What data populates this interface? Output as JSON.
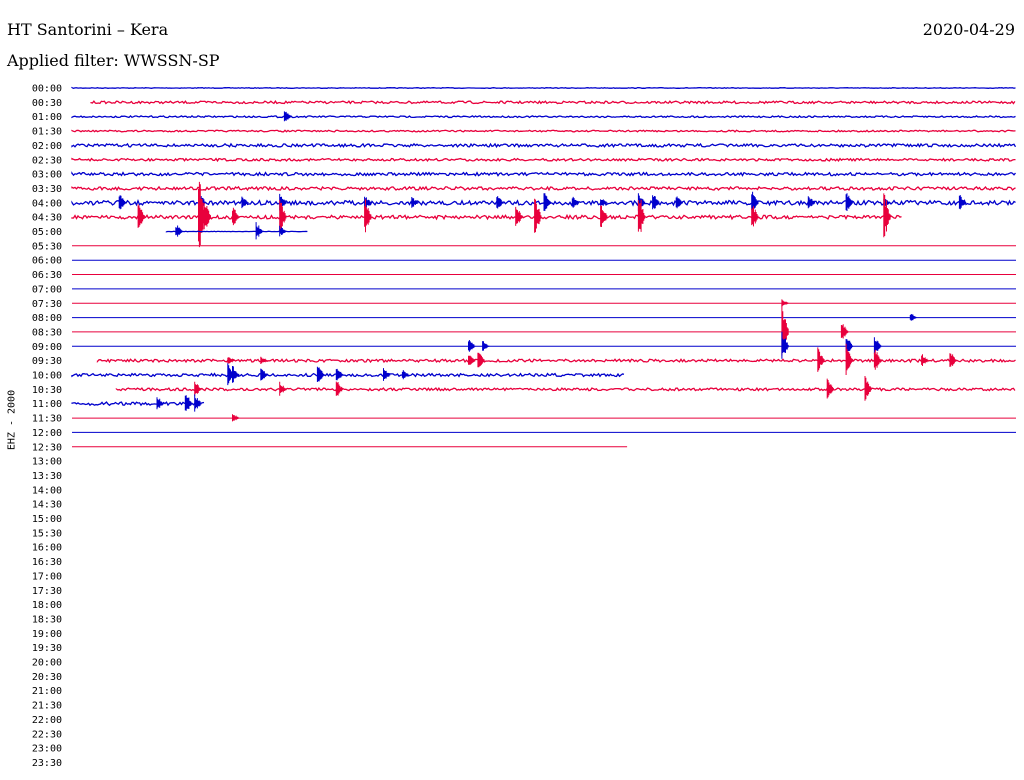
{
  "header": {
    "title": "HT Santorini – Kera",
    "date": "2020-04-29",
    "filter": "Applied filter: WWSSN-SP"
  },
  "channel_label": "EHZ - 2000",
  "colors": {
    "even_trace": "#0000cc",
    "odd_trace": "#e8003c"
  },
  "chart_data": {
    "type": "line",
    "title": "HT Santorini – Kera",
    "subtitle": "Applied filter: WWSSN-SP",
    "ylabel": "EHZ - 2000",
    "xlabel": "",
    "row_labels": [
      "00:00",
      "00:30",
      "01:00",
      "01:30",
      "02:00",
      "02:30",
      "03:00",
      "03:30",
      "04:00",
      "04:30",
      "05:00",
      "05:30",
      "06:00",
      "06:30",
      "07:00",
      "07:30",
      "08:00",
      "08:30",
      "09:00",
      "09:30",
      "10:00",
      "10:30",
      "11:00",
      "11:30",
      "12:00",
      "12:30",
      "13:00",
      "13:30",
      "14:00",
      "14:30",
      "15:00",
      "15:30",
      "16:00",
      "16:30",
      "17:00",
      "17:30",
      "18:00",
      "18:30",
      "19:00",
      "19:30",
      "20:00",
      "20:30",
      "21:00",
      "21:30",
      "22:00",
      "22:30",
      "23:00",
      "23:30"
    ],
    "x_range_minutes": [
      0,
      30
    ],
    "rows": [
      {
        "row": 0,
        "start": 0,
        "end": 1,
        "noise": 0.3,
        "events": []
      },
      {
        "row": 1,
        "start": 0.02,
        "end": 1,
        "noise": 1.2,
        "events": []
      },
      {
        "row": 2,
        "start": 0,
        "end": 1,
        "noise": 0.8,
        "events": [
          {
            "pos": 0.225,
            "amp": 7,
            "width": 0.02
          }
        ]
      },
      {
        "row": 3,
        "start": 0,
        "end": 1,
        "noise": 0.8,
        "events": []
      },
      {
        "row": 4,
        "start": 0,
        "end": 1,
        "noise": 1.5,
        "events": []
      },
      {
        "row": 5,
        "start": 0,
        "end": 1,
        "noise": 1.2,
        "events": []
      },
      {
        "row": 6,
        "start": 0,
        "end": 1,
        "noise": 1.5,
        "events": []
      },
      {
        "row": 7,
        "start": 0,
        "end": 1,
        "noise": 1.6,
        "events": []
      },
      {
        "row": 8,
        "start": 0,
        "end": 1,
        "noise": 2.2,
        "events": [
          {
            "pos": 0.05,
            "amp": 10
          },
          {
            "pos": 0.134,
            "amp": 14
          },
          {
            "pos": 0.18,
            "amp": 7
          },
          {
            "pos": 0.22,
            "amp": 9
          },
          {
            "pos": 0.31,
            "amp": 8
          },
          {
            "pos": 0.36,
            "amp": 6
          },
          {
            "pos": 0.45,
            "amp": 9
          },
          {
            "pos": 0.5,
            "amp": 12
          },
          {
            "pos": 0.53,
            "amp": 8
          },
          {
            "pos": 0.56,
            "amp": 6
          },
          {
            "pos": 0.6,
            "amp": 10
          },
          {
            "pos": 0.615,
            "amp": 12
          },
          {
            "pos": 0.64,
            "amp": 9
          },
          {
            "pos": 0.72,
            "amp": 14
          },
          {
            "pos": 0.78,
            "amp": 8
          },
          {
            "pos": 0.82,
            "amp": 12
          },
          {
            "pos": 0.86,
            "amp": 6
          },
          {
            "pos": 0.94,
            "amp": 9
          }
        ]
      },
      {
        "row": 9,
        "start": 0,
        "end": 0.88,
        "noise": 1.8,
        "events": [
          {
            "pos": 0.07,
            "amp": 16
          },
          {
            "pos": 0.134,
            "amp": 44
          },
          {
            "pos": 0.14,
            "amp": 22
          },
          {
            "pos": 0.17,
            "amp": 12
          },
          {
            "pos": 0.22,
            "amp": 20
          },
          {
            "pos": 0.31,
            "amp": 22
          },
          {
            "pos": 0.47,
            "amp": 14
          },
          {
            "pos": 0.49,
            "amp": 22
          },
          {
            "pos": 0.56,
            "amp": 18
          },
          {
            "pos": 0.6,
            "amp": 28
          },
          {
            "pos": 0.72,
            "amp": 16
          },
          {
            "pos": 0.86,
            "amp": 28
          }
        ]
      },
      {
        "row": 10,
        "start": 0.1,
        "end": 0.25,
        "noise": 0.2,
        "events": [
          {
            "pos": 0.11,
            "amp": 8
          },
          {
            "pos": 0.195,
            "amp": 10
          },
          {
            "pos": 0.22,
            "amp": 6
          }
        ]
      },
      {
        "row": 11,
        "start": 0,
        "end": 1,
        "noise": 0,
        "events": []
      },
      {
        "row": 12,
        "start": 0,
        "end": 1,
        "noise": 0,
        "events": []
      },
      {
        "row": 13,
        "start": 0,
        "end": 1,
        "noise": 0,
        "events": []
      },
      {
        "row": 14,
        "start": 0,
        "end": 1,
        "noise": 0,
        "events": []
      },
      {
        "row": 15,
        "start": 0,
        "end": 1,
        "noise": 0,
        "events": [
          {
            "pos": 0.752,
            "amp": 4
          }
        ]
      },
      {
        "row": 16,
        "start": 0,
        "end": 1,
        "noise": 0,
        "events": [
          {
            "pos": 0.888,
            "amp": 5
          }
        ]
      },
      {
        "row": 17,
        "start": 0,
        "end": 1,
        "noise": 0,
        "events": [
          {
            "pos": 0.752,
            "amp": 28
          },
          {
            "pos": 0.815,
            "amp": 12
          }
        ]
      },
      {
        "row": 18,
        "start": 0,
        "end": 1,
        "noise": 0,
        "events": [
          {
            "pos": 0.42,
            "amp": 8
          },
          {
            "pos": 0.435,
            "amp": 6
          },
          {
            "pos": 0.752,
            "amp": 16
          },
          {
            "pos": 0.82,
            "amp": 14
          },
          {
            "pos": 0.85,
            "amp": 10
          }
        ]
      },
      {
        "row": 19,
        "start": 0.027,
        "end": 1,
        "noise": 1.4,
        "events": [
          {
            "pos": 0.165,
            "amp": 6
          },
          {
            "pos": 0.2,
            "amp": 5
          },
          {
            "pos": 0.42,
            "amp": 8
          },
          {
            "pos": 0.43,
            "amp": 10
          },
          {
            "pos": 0.79,
            "amp": 14
          },
          {
            "pos": 0.82,
            "amp": 18
          },
          {
            "pos": 0.85,
            "amp": 14
          },
          {
            "pos": 0.9,
            "amp": 8
          },
          {
            "pos": 0.93,
            "amp": 10
          }
        ]
      },
      {
        "row": 20,
        "start": 0,
        "end": 0.585,
        "noise": 1.4,
        "events": [
          {
            "pos": 0.165,
            "amp": 14
          },
          {
            "pos": 0.17,
            "amp": 10
          },
          {
            "pos": 0.2,
            "amp": 8
          },
          {
            "pos": 0.26,
            "amp": 12
          },
          {
            "pos": 0.28,
            "amp": 10
          },
          {
            "pos": 0.33,
            "amp": 8
          },
          {
            "pos": 0.35,
            "amp": 6
          }
        ]
      },
      {
        "row": 21,
        "start": 0.047,
        "end": 1,
        "noise": 1.3,
        "events": [
          {
            "pos": 0.13,
            "amp": 10
          },
          {
            "pos": 0.22,
            "amp": 8
          },
          {
            "pos": 0.28,
            "amp": 10
          },
          {
            "pos": 0.8,
            "amp": 12
          },
          {
            "pos": 0.84,
            "amp": 14
          }
        ]
      },
      {
        "row": 22,
        "start": 0,
        "end": 0.14,
        "noise": 1.6,
        "events": [
          {
            "pos": 0.09,
            "amp": 8
          },
          {
            "pos": 0.12,
            "amp": 14
          },
          {
            "pos": 0.13,
            "amp": 10
          }
        ]
      },
      {
        "row": 23,
        "start": 0,
        "end": 1,
        "noise": 0,
        "events": [
          {
            "pos": 0.17,
            "amp": 5
          }
        ]
      },
      {
        "row": 24,
        "start": 0,
        "end": 1,
        "noise": 0,
        "events": []
      },
      {
        "row": 25,
        "start": 0,
        "end": 0.588,
        "noise": 0,
        "events": []
      }
    ],
    "grid": false,
    "legend": "none"
  }
}
